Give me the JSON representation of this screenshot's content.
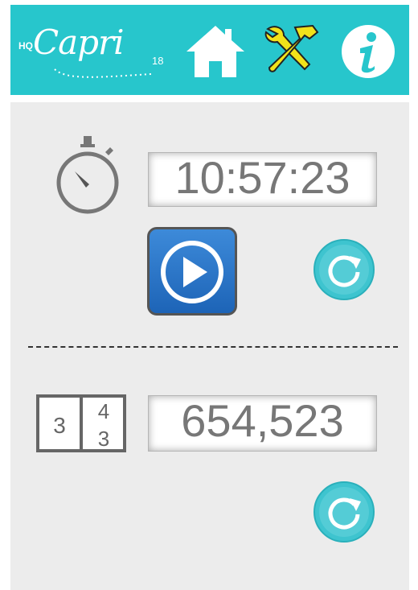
{
  "header": {
    "logo": {
      "prefix": "HQ",
      "name": "Capri",
      "suffix": "18"
    },
    "buttons": [
      "home",
      "tools",
      "info"
    ],
    "background": "#27c6cc"
  },
  "timer": {
    "value": "10:57:23",
    "play_button_color": "#2a74c7",
    "reset_color": "#3ec4cf"
  },
  "counter": {
    "icon_digits": {
      "left": "3",
      "right_top": "4",
      "right_bottom": "3"
    },
    "value": "654,523",
    "reset_color": "#3ec4cf"
  }
}
